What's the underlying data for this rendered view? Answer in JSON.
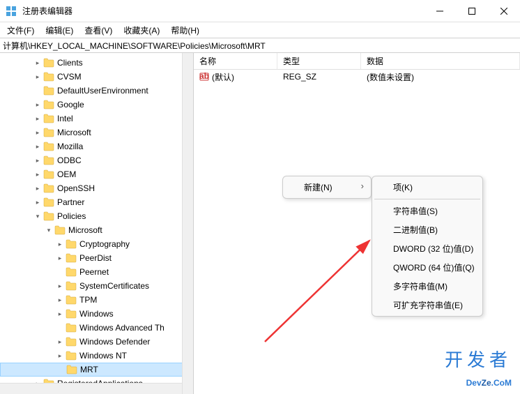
{
  "window": {
    "title": "注册表编辑器"
  },
  "menu": {
    "file": "文件(F)",
    "edit": "编辑(E)",
    "view": "查看(V)",
    "favorites": "收藏夹(A)",
    "help": "帮助(H)"
  },
  "address": "计算机\\HKEY_LOCAL_MACHINE\\SOFTWARE\\Policies\\Microsoft\\MRT",
  "tree": [
    {
      "indent": 3,
      "exp": ">",
      "label": "Clients"
    },
    {
      "indent": 3,
      "exp": ">",
      "label": "CVSM"
    },
    {
      "indent": 3,
      "exp": "",
      "label": "DefaultUserEnvironment"
    },
    {
      "indent": 3,
      "exp": ">",
      "label": "Google"
    },
    {
      "indent": 3,
      "exp": ">",
      "label": "Intel"
    },
    {
      "indent": 3,
      "exp": ">",
      "label": "Microsoft"
    },
    {
      "indent": 3,
      "exp": ">",
      "label": "Mozilla"
    },
    {
      "indent": 3,
      "exp": ">",
      "label": "ODBC"
    },
    {
      "indent": 3,
      "exp": ">",
      "label": "OEM"
    },
    {
      "indent": 3,
      "exp": ">",
      "label": "OpenSSH"
    },
    {
      "indent": 3,
      "exp": ">",
      "label": "Partner"
    },
    {
      "indent": 3,
      "exp": "v",
      "label": "Policies"
    },
    {
      "indent": 4,
      "exp": "v",
      "label": "Microsoft"
    },
    {
      "indent": 5,
      "exp": ">",
      "label": "Cryptography"
    },
    {
      "indent": 5,
      "exp": ">",
      "label": "PeerDist"
    },
    {
      "indent": 5,
      "exp": "",
      "label": "Peernet"
    },
    {
      "indent": 5,
      "exp": ">",
      "label": "SystemCertificates"
    },
    {
      "indent": 5,
      "exp": ">",
      "label": "TPM"
    },
    {
      "indent": 5,
      "exp": ">",
      "label": "Windows"
    },
    {
      "indent": 5,
      "exp": "",
      "label": "Windows Advanced Th"
    },
    {
      "indent": 5,
      "exp": ">",
      "label": "Windows Defender"
    },
    {
      "indent": 5,
      "exp": ">",
      "label": "Windows NT"
    },
    {
      "indent": 5,
      "exp": "",
      "label": "MRT",
      "selected": true
    },
    {
      "indent": 3,
      "exp": ">",
      "label": "RegisteredApplications"
    }
  ],
  "list": {
    "headers": {
      "name": "名称",
      "type": "类型",
      "data": "数据"
    },
    "rows": [
      {
        "name": "(默认)",
        "type": "REG_SZ",
        "data": "(数值未设置)"
      }
    ]
  },
  "context1": {
    "new": "新建(N)"
  },
  "context2": {
    "key": "项(K)",
    "string": "字符串值(S)",
    "binary": "二进制值(B)",
    "dword": "DWORD (32 位)值(D)",
    "qword": "QWORD (64 位)值(Q)",
    "multi": "多字符串值(M)",
    "expand": "可扩充字符串值(E)"
  },
  "watermark": {
    "line1": "开发者",
    "line2a": "Dev",
    "line2b": "Ze",
    "line2c": ".CoM"
  }
}
